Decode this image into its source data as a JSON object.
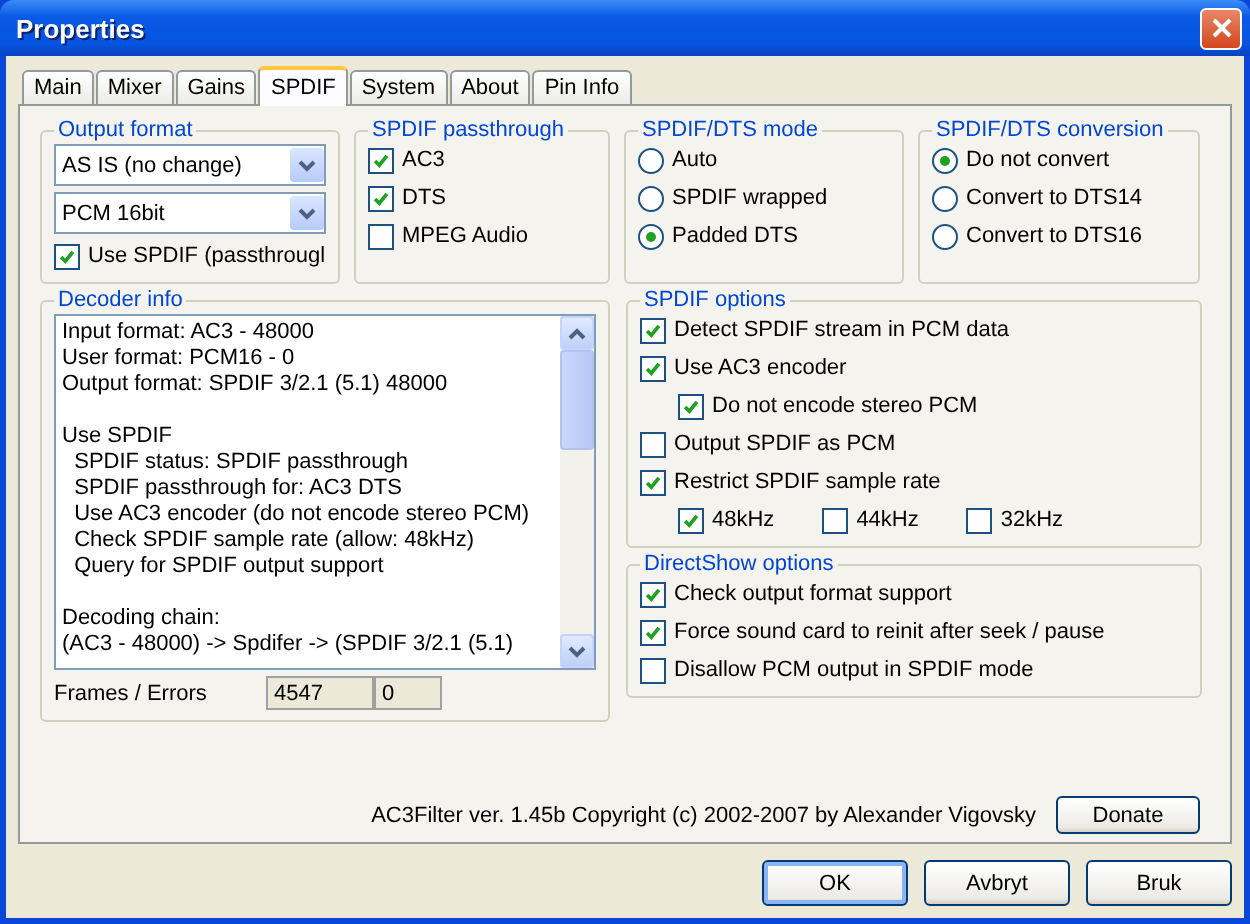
{
  "window": {
    "title": "Properties"
  },
  "tabs": [
    {
      "label": "Main",
      "selected": false
    },
    {
      "label": "Mixer",
      "selected": false
    },
    {
      "label": "Gains",
      "selected": false
    },
    {
      "label": "SPDIF",
      "selected": true
    },
    {
      "label": "System",
      "selected": false
    },
    {
      "label": "About",
      "selected": false
    },
    {
      "label": "Pin Info",
      "selected": false
    }
  ],
  "output_format": {
    "title": "Output format",
    "dropdowns": [
      {
        "value": "AS IS (no change)"
      },
      {
        "value": "PCM 16bit"
      }
    ],
    "checkbox": {
      "label": "Use SPDIF (passthrougl",
      "checked": true
    }
  },
  "spdif_passthrough": {
    "title": "SPDIF passthrough",
    "options": [
      {
        "label": "AC3",
        "checked": true
      },
      {
        "label": "DTS",
        "checked": true
      },
      {
        "label": "MPEG Audio",
        "checked": false
      }
    ]
  },
  "spdif_dts_mode": {
    "title": "SPDIF/DTS mode",
    "options": [
      {
        "label": "Auto",
        "selected": false
      },
      {
        "label": "SPDIF wrapped",
        "selected": false
      },
      {
        "label": "Padded DTS",
        "selected": true
      }
    ]
  },
  "spdif_dts_conversion": {
    "title": "SPDIF/DTS conversion",
    "options": [
      {
        "label": "Do not convert",
        "selected": true
      },
      {
        "label": "Convert to DTS14",
        "selected": false
      },
      {
        "label": "Convert to DTS16",
        "selected": false
      }
    ]
  },
  "decoder_info": {
    "title": "Decoder info",
    "paragraphs": [
      [
        "Input format: AC3 - 48000",
        "User format: PCM16 - 0",
        "Output format: SPDIF 3/2.1 (5.1) 48000"
      ],
      [
        "Use SPDIF",
        "  SPDIF status: SPDIF passthrough",
        "  SPDIF passthrough for: AC3 DTS",
        "  Use AC3 encoder (do not encode stereo PCM)",
        "  Check SPDIF sample rate (allow: 48kHz)",
        "  Query for SPDIF output support"
      ],
      [
        "Decoding chain:",
        "(AC3 - 48000) -> Spdifer -> (SPDIF 3/2.1 (5.1)"
      ]
    ],
    "frames_label": "Frames / Errors",
    "frames": "4547",
    "errors": "0"
  },
  "spdif_options": {
    "title": "SPDIF options",
    "items": [
      {
        "label": "Detect SPDIF stream in PCM data",
        "checked": true
      },
      {
        "label": "Use AC3 encoder",
        "checked": true,
        "children": [
          {
            "label": "Do not encode stereo PCM",
            "checked": true,
            "kind": "stacked"
          }
        ]
      },
      {
        "label": "Output SPDIF as PCM",
        "checked": false
      },
      {
        "label": "Restrict SPDIF sample rate",
        "checked": true,
        "children": [
          {
            "label": "48kHz",
            "checked": true,
            "kind": "inline"
          },
          {
            "label": "44kHz",
            "checked": false,
            "kind": "inline"
          },
          {
            "label": "32kHz",
            "checked": false,
            "kind": "inline"
          }
        ]
      }
    ]
  },
  "directshow_options": {
    "title": "DirectShow options",
    "items": [
      {
        "label": "Check output format support",
        "checked": true
      },
      {
        "label": "Force sound card to reinit after seek / pause",
        "checked": true
      },
      {
        "label": "Disallow PCM output in SPDIF mode",
        "checked": false
      }
    ]
  },
  "footer": {
    "copyright": "AC3Filter ver. 1.45b Copyright (c) 2002-2007 by Alexander Vigovsky",
    "donate": "Donate"
  },
  "buttons": [
    {
      "label": "OK",
      "default": true
    },
    {
      "label": "Avbryt",
      "default": false
    },
    {
      "label": "Bruk",
      "default": false
    }
  ]
}
